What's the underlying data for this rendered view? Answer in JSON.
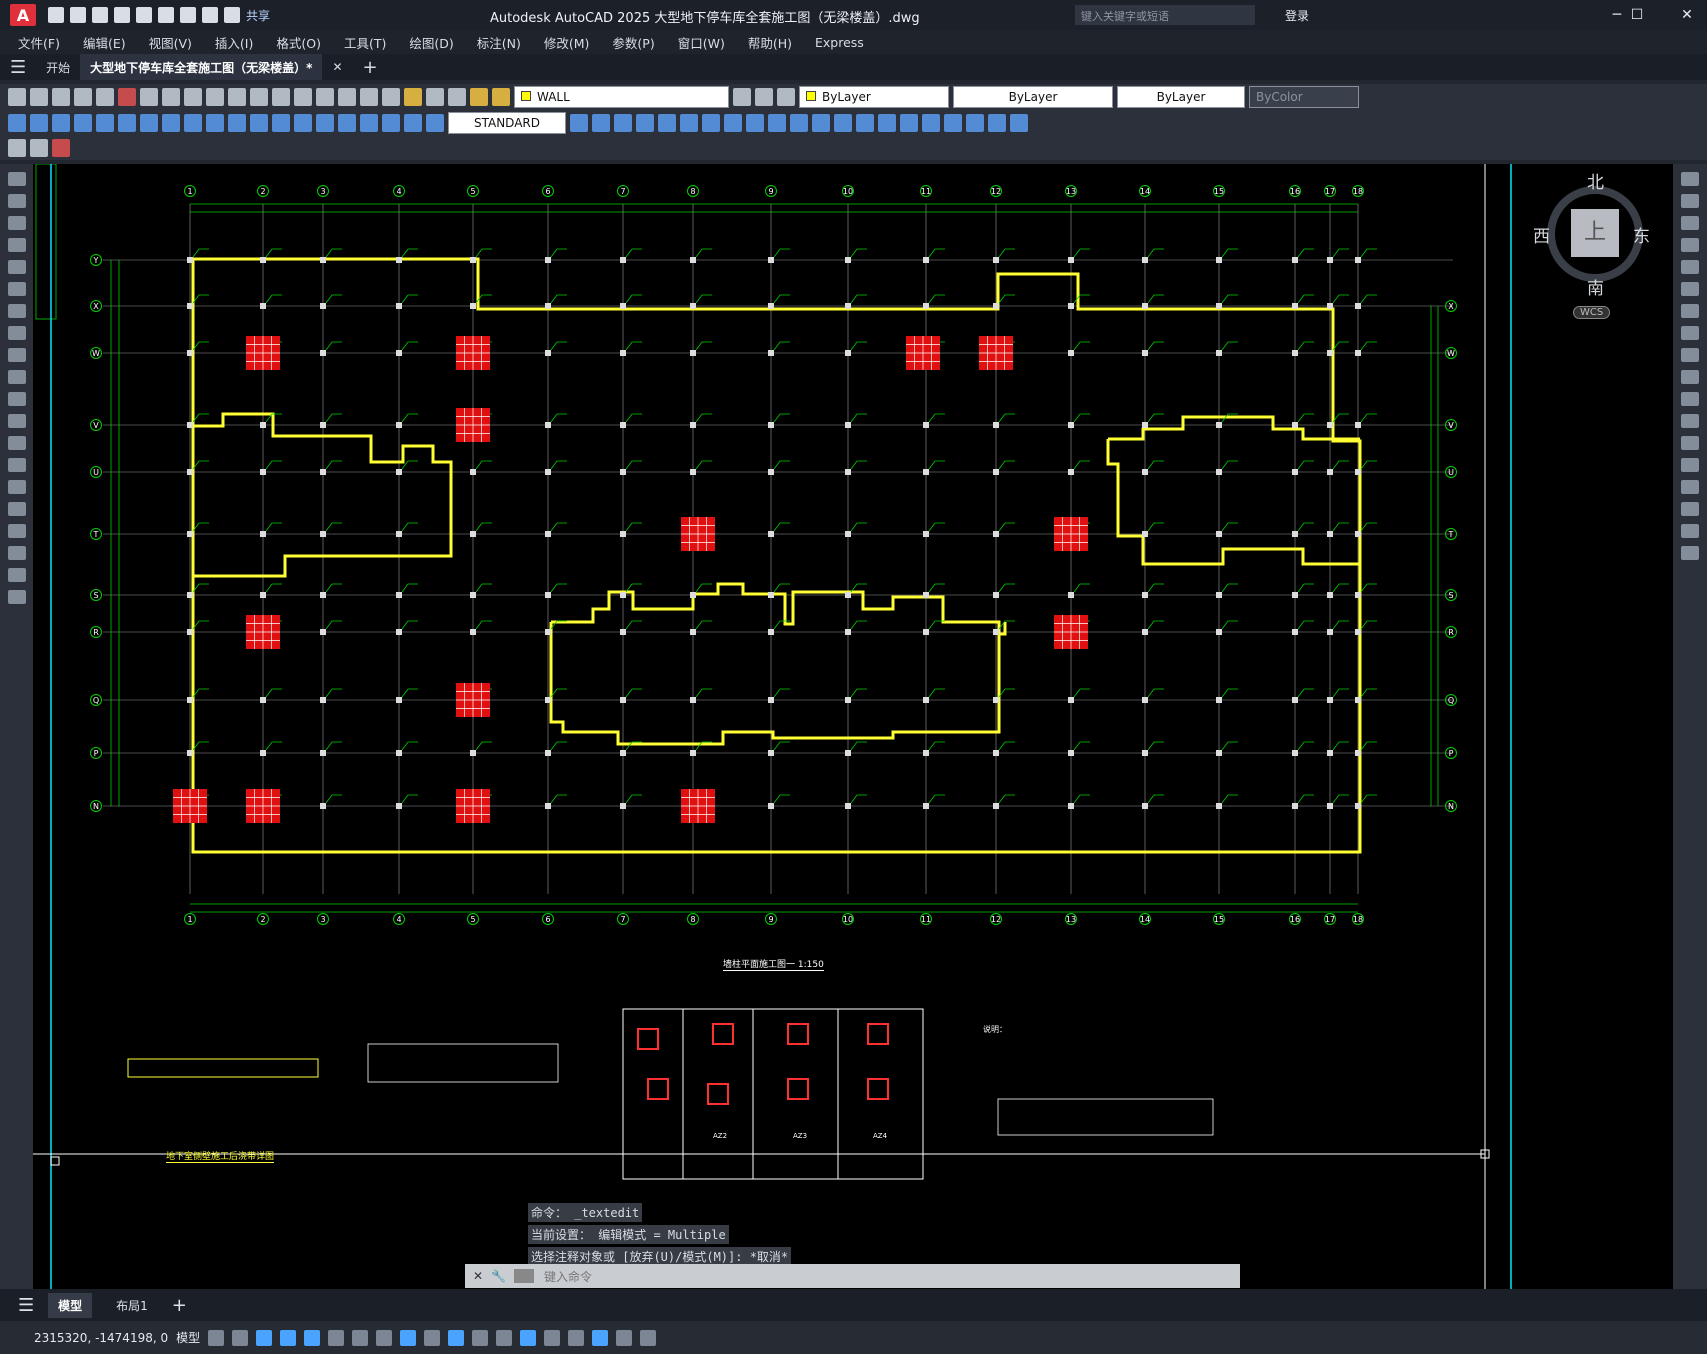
{
  "app": {
    "title": "Autodesk AutoCAD 2025    大型地下停车库全套施工图（无梁楼盖）.dwg",
    "share": "共享",
    "search_placeholder": "键入关键字或短语",
    "login": "登录"
  },
  "menu": [
    "文件(F)",
    "编辑(E)",
    "视图(V)",
    "插入(I)",
    "格式(O)",
    "工具(T)",
    "绘图(D)",
    "标注(N)",
    "修改(M)",
    "参数(P)",
    "窗口(W)",
    "帮助(H)",
    "Express"
  ],
  "tabs": {
    "start": "开始",
    "document": "大型地下停车库全套施工图（无梁楼盖）*"
  },
  "toolbar": {
    "layer": "WALL",
    "color": "ByLayer",
    "linetype": "ByLayer",
    "lineweight": "ByLayer",
    "plotstyle": "ByColor",
    "textstyle": "STANDARD"
  },
  "drawing": {
    "grid_top": [
      "1",
      "2",
      "3",
      "4",
      "5",
      "6",
      "7",
      "8",
      "9",
      "10",
      "11",
      "12",
      "13",
      "14",
      "15",
      "16",
      "17",
      "18"
    ],
    "grid_left": [
      "Y",
      "X",
      "W",
      "V",
      "U",
      "T",
      "S",
      "R",
      "Q",
      "P",
      "N"
    ],
    "plan_title": "墙柱平面施工图一  1:150",
    "detail_title": "地下室侧壁施工后浇带详图",
    "notes_title": "说明：",
    "column_labels": [
      "AZ2",
      "AZ3",
      "AZ4"
    ]
  },
  "viewcube": {
    "north": "北",
    "south": "南",
    "east": "东",
    "west": "西",
    "top": "上",
    "wcs": "WCS"
  },
  "command": {
    "line1": "命令： _textedit",
    "line2": "当前设置： 编辑模式 = Multiple",
    "line3": "选择注释对象或 [放弃(U)/模式(M)]: *取消*",
    "placeholder": "键入命令"
  },
  "layout_tabs": [
    "模型",
    "布局1"
  ],
  "status": {
    "coords": "2315320, -1474198, 0",
    "mode": "模型"
  }
}
